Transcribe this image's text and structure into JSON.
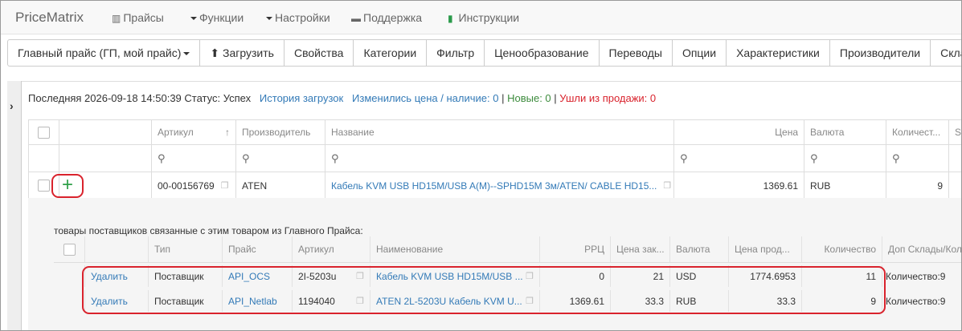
{
  "app": {
    "brand": "PriceMatrix",
    "nav": {
      "prices": "Прайсы",
      "functions": "Функции",
      "settings": "Настройки",
      "support": "Поддержка",
      "instructions": "Инструкции"
    }
  },
  "toolbar": {
    "main_price": "Главный прайс (ГП, мой прайс)",
    "upload": "Загрузить",
    "properties": "Свойства",
    "categories": "Категории",
    "filter": "Фильтр",
    "pricing": "Ценообразование",
    "translations": "Переводы",
    "options": "Опции",
    "characteristics": "Характеристики",
    "manufacturers": "Производители",
    "warehouses": "Скла"
  },
  "status": {
    "last": "Последняя 2026-09-18 14:50:39 Статус: Успех",
    "history_link": "История загрузок",
    "changed": "Изменились цена / наличие: 0",
    "sep1": "|",
    "new": "Новые: 0",
    "sep2": "|",
    "gone": "Ушли из продажи: 0"
  },
  "grid": {
    "headers": {
      "article": "Артикул",
      "sort_arrow": "↑",
      "manufacturer": "Производитель",
      "name": "Название",
      "price": "Цена",
      "currency": "Валюта",
      "quantity": "Количест...",
      "extra": "Sk"
    },
    "row": {
      "article": "00-00156769",
      "manufacturer": "ATEN",
      "name": "Кабель KVM USB HD15M/USB A(M)--SPHD15M 3м/ATEN/ CABLE HD15...",
      "price": "1369.61",
      "currency": "RUB",
      "quantity": "9"
    }
  },
  "detail": {
    "title": "товары поставщиков связанные с этим товаром из Главного Прайса:",
    "headers": {
      "type": "Тип",
      "price_list": "Прайс",
      "article": "Артикул",
      "name": "Наименование",
      "rrp": "РРЦ",
      "purchase": "Цена зак...",
      "currency": "Валюта",
      "sale": "Цена прод...",
      "quantity": "Количество",
      "extra": "Доп Склады/Кол"
    },
    "rows": [
      {
        "action": "Удалить",
        "type": "Поставщик",
        "price_list": "API_OCS",
        "article": "2I-5203u",
        "name": "Кабель KVM USB HD15M/USB ...",
        "rrp": "0",
        "purchase": "21",
        "currency": "USD",
        "sale": "1774.6953",
        "quantity": "11",
        "extra": "Количество:9"
      },
      {
        "action": "Удалить",
        "type": "Поставщик",
        "price_list": "API_Netlab",
        "article": "1194040",
        "name": "ATEN 2L-5203U Кабель KVM U...",
        "rrp": "1369.61",
        "purchase": "33.3",
        "currency": "RUB",
        "sale": "33.3",
        "quantity": "9",
        "extra": "Количество:9"
      }
    ]
  },
  "icons": {
    "barcode": "barcode-icon",
    "caret": "caret-down-icon",
    "chat": "chat-icon",
    "book": "book-icon",
    "upload": "upload-icon",
    "search": "search-icon",
    "copy": "copy-icon",
    "plus": "plus-icon",
    "chevron": "chevron-right-icon"
  },
  "colors": {
    "link": "#337ab7",
    "red": "#d9232d",
    "green": "#3c8b3c",
    "plus": "#2fa04a"
  }
}
